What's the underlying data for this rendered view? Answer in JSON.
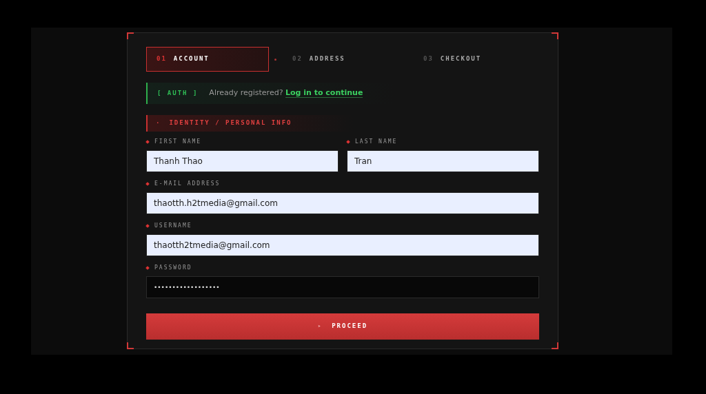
{
  "steps": [
    {
      "number": "01",
      "label": "ACCOUNT",
      "selected": true
    },
    {
      "number": "02",
      "label": "ADDRESS",
      "selected": false
    },
    {
      "number": "03",
      "label": "CHECKOUT",
      "selected": false
    }
  ],
  "auth": {
    "tag": "[ AUTH ]",
    "text": "Already registered?",
    "link": "Log in to continue"
  },
  "section": {
    "marker": "·",
    "title": "IDENTITY / PERSONAL INFO"
  },
  "fields": [
    {
      "label": "FIRST NAME",
      "value": "Thanh Thao",
      "kind": "text",
      "half": true
    },
    {
      "label": "LAST NAME",
      "value": "Tran",
      "kind": "text",
      "half": true
    },
    {
      "label": "E-MAIL ADDRESS",
      "value": "thaotth.h2tmedia@gmail.com",
      "kind": "text",
      "half": false
    },
    {
      "label": "USERNAME",
      "value": "thaotth2tmedia@gmail.com",
      "kind": "text",
      "half": false
    },
    {
      "label": "PASSWORD",
      "value": "••••••••••••••••••",
      "kind": "secret",
      "half": false
    }
  ],
  "button": {
    "icon": "➤",
    "label": "PROCEED"
  }
}
